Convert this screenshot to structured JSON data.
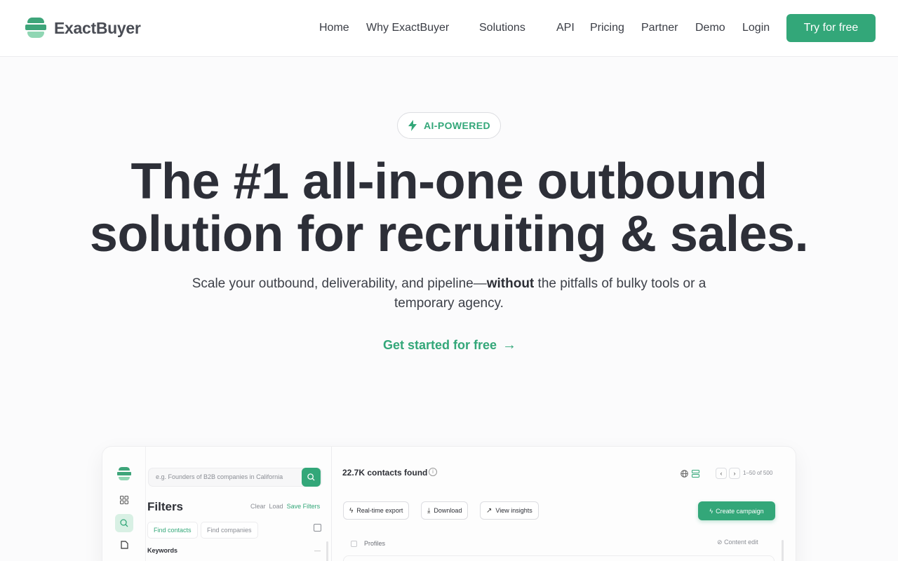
{
  "brand": {
    "name": "ExactBuyer",
    "accent": "#33a779"
  },
  "nav": {
    "items": [
      "Home",
      "Why ExactBuyer",
      "Solutions",
      "API",
      "Pricing",
      "Partner",
      "Demo",
      "Login"
    ],
    "cta": "Try for free"
  },
  "hero": {
    "badge": "AI-POWERED",
    "badge_icon": "bolt-icon",
    "headline_line1": "The #1 all-in-one outbound",
    "headline_line2": "solution for recruiting & sales.",
    "sub_before": "Scale your outbound, deliverability, and pipeline—",
    "sub_bold": "without",
    "sub_after": " the pitfalls of bulky tools or a temporary agency.",
    "cta": "Get started for free",
    "cta_arrow": "→"
  },
  "app": {
    "search_placeholder": "e.g. Founders of B2B companies in California",
    "filters_title": "Filters",
    "clear": "Clear",
    "load": "Load",
    "save_filters": "Save Filters",
    "tabs": [
      "Find contacts",
      "Find companies"
    ],
    "keywords": "Keywords",
    "keywords_dash": "—",
    "count": "22.7K contacts found",
    "range": "1–50 of 500",
    "actions": [
      "Real-time export",
      "Download",
      "View insights"
    ],
    "create_campaign": "Create campaign",
    "profiles": "Profiles",
    "content_edit": "Content edit"
  }
}
